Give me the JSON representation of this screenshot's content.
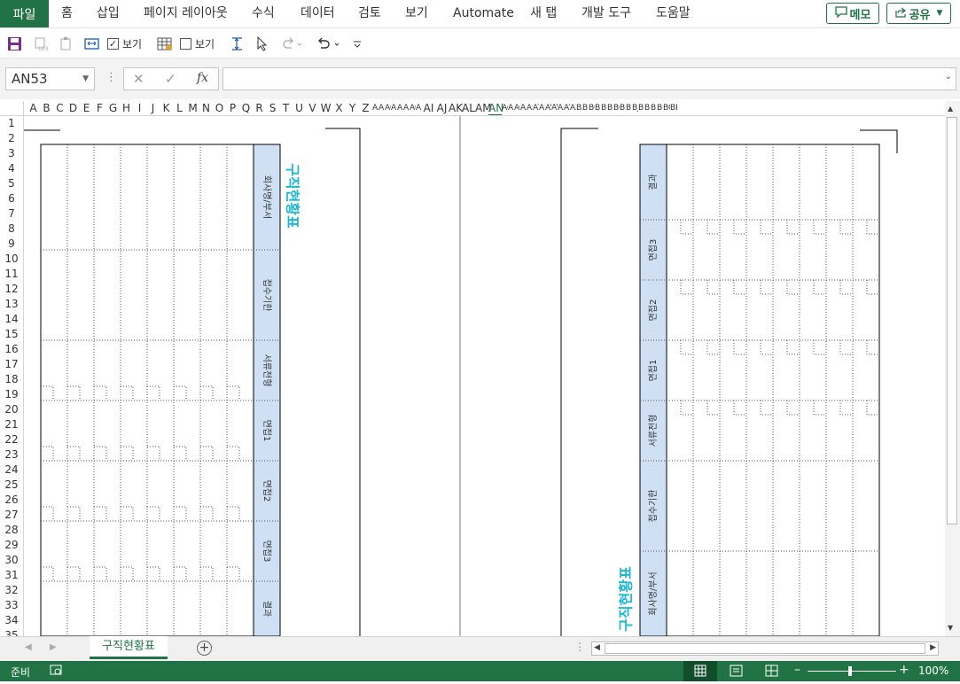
{
  "ribbon_tabs": [
    "파일",
    "홈",
    "삽입",
    "페이지 레이아웃",
    "수식",
    "데이터",
    "검토",
    "보기",
    "Automate",
    "새 탭",
    "개발 도구",
    "도움말"
  ],
  "buttons": {
    "memo": "메모",
    "share": "공유"
  },
  "qat": {
    "view1": "보기",
    "view2": "보기"
  },
  "formula_bar": {
    "name_box": "AN53",
    "fx": "fx",
    "content": ""
  },
  "col_headers": [
    "A",
    "B",
    "C",
    "D",
    "E",
    "F",
    "G",
    "H",
    "I",
    "J",
    "K",
    "L",
    "M",
    "N",
    "O",
    "P",
    "Q",
    "R",
    "S",
    "T",
    "U",
    "V",
    "W",
    "X",
    "Y",
    "Z",
    "AA",
    "AB",
    "AC",
    "AD",
    "AE",
    "AF",
    "AG",
    "AH",
    "AI",
    "AJ",
    "AK",
    "AL",
    "AM",
    "AN",
    "AO",
    "AP",
    "AQ",
    "AR",
    "AS",
    "AT",
    "AU",
    "AV",
    "AW",
    "AX",
    "AY",
    "AZ",
    "BA",
    "BB",
    "BC",
    "BD",
    "BE",
    "BF",
    "BG",
    "BH",
    "BI",
    "BJ",
    "BK",
    "BL",
    "BM",
    "BN",
    "BO",
    "BP"
  ],
  "row_headers": [
    "1",
    "2",
    "3",
    "4",
    "5",
    "6",
    "7",
    "8",
    "9",
    "10",
    "11",
    "12",
    "13",
    "14",
    "15",
    "16",
    "17",
    "18",
    "19",
    "20",
    "21",
    "22",
    "23",
    "24",
    "25",
    "26",
    "27",
    "28",
    "29",
    "30",
    "31",
    "32",
    "33",
    "34",
    "35"
  ],
  "form": {
    "title": "구직현황표",
    "labels_left": [
      "회사명/부서",
      "접수기한",
      "서류전형",
      "면접1",
      "면접2",
      "면접3",
      "결과"
    ],
    "labels_right": [
      "결과",
      "면접3",
      "면접2",
      "면접1",
      "서류전형",
      "접수기한",
      "회사명/부서"
    ]
  },
  "sheet_tab": {
    "name": "구직현황표"
  },
  "status": {
    "ready": "준비",
    "zoom": "100%"
  },
  "colors": {
    "accent": "#217346",
    "header_fill": "#cfe0f5",
    "title": "#1fb6d3"
  }
}
